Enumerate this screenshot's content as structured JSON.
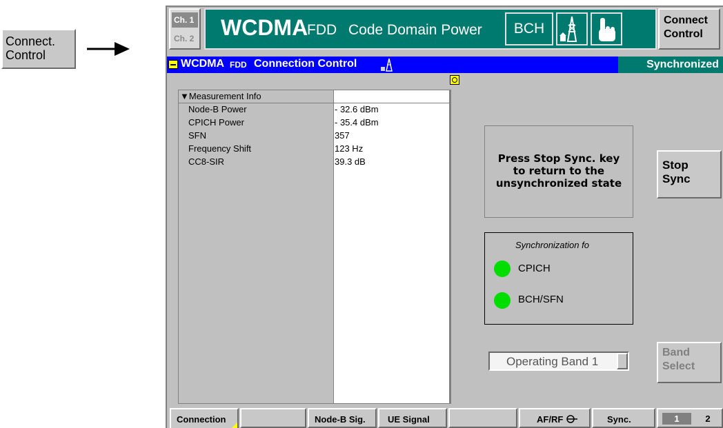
{
  "softkey_outside": {
    "line1": "Connect.",
    "line2": "Control"
  },
  "header": {
    "ch1": "Ch. 1",
    "ch2": "Ch. 2",
    "title_main": "WCDMA",
    "title_fdd": "FDD",
    "title_sub": "Code Domain Power",
    "bch": "BCH",
    "connect_line1": "Connect",
    "connect_line2": "Control"
  },
  "window": {
    "title_wcdma": "WCDMA",
    "title_fdd": "FDD",
    "title_rest": "Connection Control",
    "status": "Synchronized"
  },
  "measurement": {
    "header": "Measurement Info",
    "rows": [
      {
        "label": "Node-B Power",
        "value": "- 32.6  dBm"
      },
      {
        "label": "CPICH Power",
        "value": "- 35.4  dBm"
      },
      {
        "label": "SFN",
        "value": "357"
      },
      {
        "label": "Frequency Shift",
        "value": "123  Hz"
      },
      {
        "label": "CC8-SIR",
        "value": "39.3  dB"
      }
    ]
  },
  "message": {
    "line1": "Press Stop Sync. key",
    "line2": "to return to the",
    "line3": "unsynchronized state"
  },
  "sync_info": {
    "title": "Synchronization fo",
    "items": [
      {
        "label": "CPICH",
        "color": "#00dd00"
      },
      {
        "label": "BCH/SFN",
        "color": "#00dd00"
      }
    ]
  },
  "operating_band": "Operating Band 1",
  "side_buttons": {
    "stop_line1": "Stop",
    "stop_line2": "Sync",
    "band_line1": "Band",
    "band_line2": "Select"
  },
  "bottom_tabs": {
    "connection": "Connection",
    "empty1": "",
    "node_b": "Node-B Sig.",
    "ue_signal": "UE Signal",
    "empty2": "",
    "afrf": "AF/RF",
    "sync": "Sync.",
    "page1": "1",
    "page2": "2"
  },
  "colors": {
    "title_bar_blue": "#0000ff",
    "status_green": "#007a6e",
    "header_teal": "#007a6e",
    "panel_gray": "#c0c0c0",
    "led_green": "#00dd00"
  }
}
